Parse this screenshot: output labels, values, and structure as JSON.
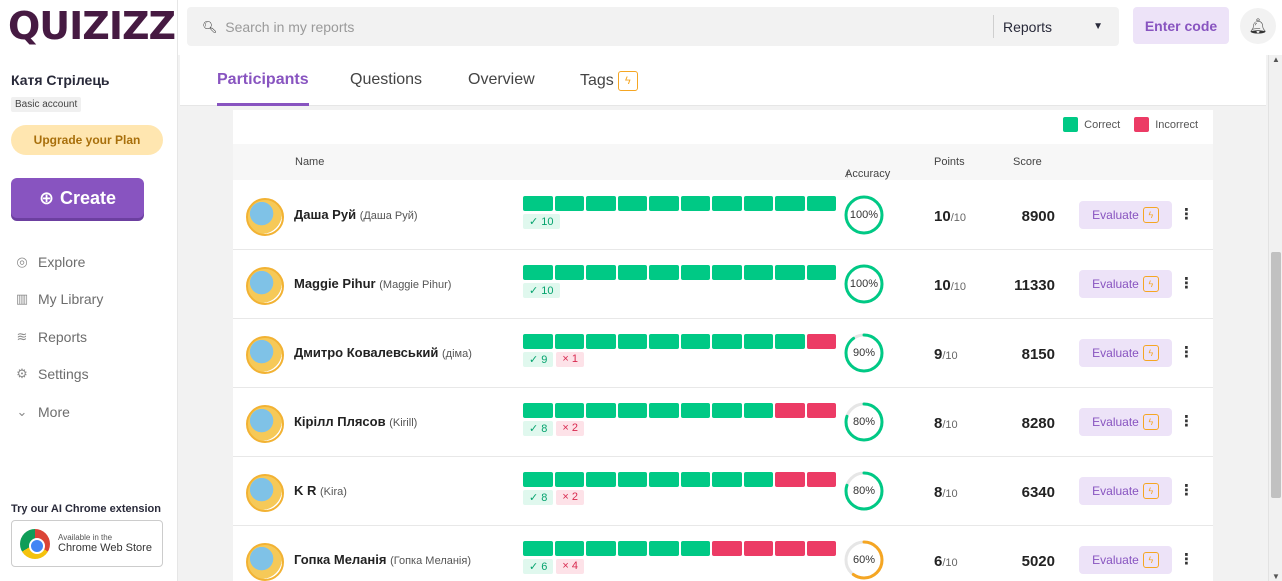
{
  "app": {
    "logo": "QUIZIZZ"
  },
  "user": {
    "name": "Катя Стрілець",
    "account": "Basic account"
  },
  "sidebar": {
    "upgrade_label": "Upgrade your Plan",
    "create_label": "Create",
    "nav": [
      {
        "label": "Explore",
        "icon": "compass-icon"
      },
      {
        "label": "My Library",
        "icon": "library-icon"
      },
      {
        "label": "Reports",
        "icon": "reports-icon"
      },
      {
        "label": "Settings",
        "icon": "gear-icon"
      },
      {
        "label": "More",
        "icon": "chevron-down-icon"
      }
    ],
    "chrome_title": "Try our AI Chrome extension",
    "chrome_small": "Available in the",
    "chrome_big": "Chrome Web Store"
  },
  "topbar": {
    "search_placeholder": "Search in my reports",
    "filter_value": "Reports",
    "enter_code": "Enter code"
  },
  "tabs": [
    {
      "label": "Participants",
      "active": true
    },
    {
      "label": "Questions",
      "active": false
    },
    {
      "label": "Overview",
      "active": false
    },
    {
      "label": "Tags",
      "active": false,
      "pro": true
    }
  ],
  "legend": {
    "correct": "Correct",
    "incorrect": "Incorrect"
  },
  "colors": {
    "correct": "#00c985",
    "incorrect": "#ec3b65",
    "accent": "#8854c0",
    "ring_partial": "#f5a623"
  },
  "table": {
    "headers": {
      "name": "Name",
      "accuracy": "Accuracy",
      "points": "Points",
      "score": "Score"
    },
    "evaluate_label": "Evaluate",
    "total_questions": 10,
    "rows": [
      {
        "name": "Даша Руй",
        "alias": "(Даша Руй)",
        "correct": 10,
        "incorrect": 0,
        "accuracy": "100%",
        "accuracy_value": 100,
        "points": "10",
        "points_total": "/10",
        "score": "8900",
        "answers": "cccccccccc"
      },
      {
        "name": "Maggie Pihur",
        "alias": "(Maggie Pihur)",
        "correct": 10,
        "incorrect": 0,
        "accuracy": "100%",
        "accuracy_value": 100,
        "points": "10",
        "points_total": "/10",
        "score": "11330",
        "answers": "cccccccccc"
      },
      {
        "name": "Дмитро Ковалевський",
        "alias": "(діма)",
        "correct": 9,
        "incorrect": 1,
        "accuracy": "90%",
        "accuracy_value": 90,
        "points": "9",
        "points_total": "/10",
        "score": "8150",
        "answers": "cccccccccі"
      },
      {
        "name": "Кірілл Плясов",
        "alias": "(Kirill)",
        "correct": 8,
        "incorrect": 2,
        "accuracy": "80%",
        "accuracy_value": 80,
        "points": "8",
        "points_total": "/10",
        "score": "8280",
        "answers": "ccccccccii"
      },
      {
        "name": "K R",
        "alias": "(Kira)",
        "correct": 8,
        "incorrect": 2,
        "accuracy": "80%",
        "accuracy_value": 80,
        "points": "8",
        "points_total": "/10",
        "score": "6340",
        "answers": "ccccccccii"
      },
      {
        "name": "Гопка Меланія",
        "alias": "(Гопка Меланія)",
        "correct": 6,
        "incorrect": 4,
        "accuracy": "60%",
        "accuracy_value": 60,
        "points": "6",
        "points_total": "/10",
        "score": "5020",
        "answers": "cccccciiii"
      }
    ]
  }
}
